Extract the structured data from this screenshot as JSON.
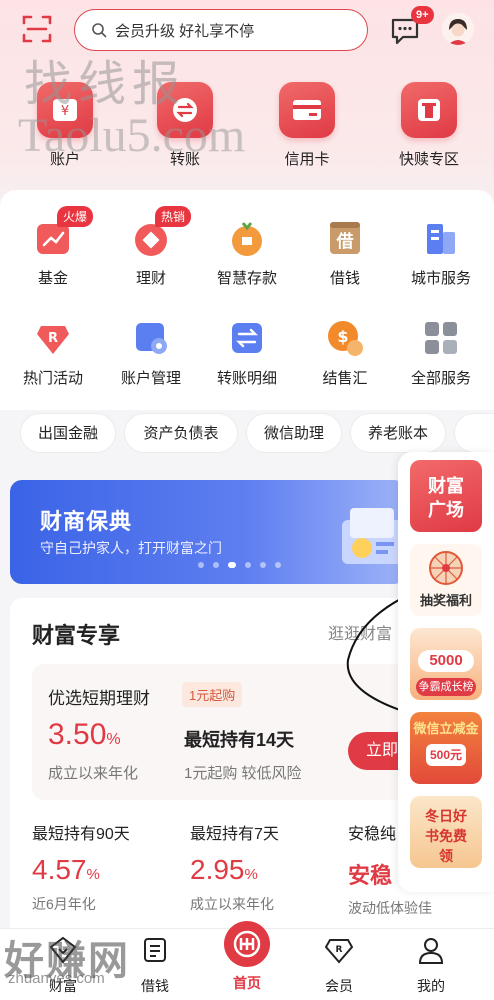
{
  "header": {
    "search_placeholder": "会员升级 好礼享不停",
    "message_badge": "9+"
  },
  "quick_tiles": [
    {
      "label": "账户",
      "icon": "wallet-icon"
    },
    {
      "label": "转账",
      "icon": "transfer-icon"
    },
    {
      "label": "信用卡",
      "icon": "credit-card-icon"
    },
    {
      "label": "快赎专区",
      "icon": "redeem-icon"
    }
  ],
  "services": [
    {
      "label": "基金",
      "icon": "fund-icon",
      "tag": "火爆"
    },
    {
      "label": "理财",
      "icon": "finance-icon",
      "tag": "热销"
    },
    {
      "label": "智慧存款",
      "icon": "deposit-icon"
    },
    {
      "label": "借钱",
      "icon": "borrow-icon",
      "glyph": "借"
    },
    {
      "label": "城市服务",
      "icon": "city-icon"
    },
    {
      "label": "热门活动",
      "icon": "activity-icon"
    },
    {
      "label": "账户管理",
      "icon": "account-manage-icon"
    },
    {
      "label": "转账明细",
      "icon": "transfer-detail-icon"
    },
    {
      "label": "结售汇",
      "icon": "exchange-icon"
    },
    {
      "label": "全部服务",
      "icon": "all-services-icon"
    }
  ],
  "chips": [
    "出国金融",
    "资产负债表",
    "微信助理",
    "养老账本"
  ],
  "banner": {
    "title": "财商保典",
    "subtitle": "守自己护家人，打开财富之门"
  },
  "side_panel": {
    "wealth_plaza": "财富广场",
    "lottery": "抽奖福利",
    "growth_amount": "5000",
    "growth_button": "争霸成长榜",
    "wechat_title": "微信立减金",
    "wechat_amount": "500元",
    "book_title": "冬日好书免费领"
  },
  "wealth": {
    "title": "财富专享",
    "more": "逛逛财富",
    "featured": {
      "name": "优选短期理财",
      "tag": "1元起购",
      "rate": "3.50",
      "rate_unit": "%",
      "rate_desc": "成立以来年化",
      "hold": "最短持有14天",
      "hold_desc": "1元起购 较低风险",
      "button": "立即"
    },
    "products": [
      {
        "head": "最短持有90天",
        "value": "4.57",
        "unit": "%",
        "desc": "近6月年化"
      },
      {
        "head": "最短持有7天",
        "value": "2.95",
        "unit": "%",
        "desc": "成立以来年化"
      },
      {
        "head": "安稳纯",
        "value": "安稳",
        "unit": "",
        "desc": "波动低体验佳"
      }
    ]
  },
  "nav": [
    {
      "label": "财富",
      "icon": "wealth-icon"
    },
    {
      "label": "借钱",
      "icon": "borrow-nav-icon"
    },
    {
      "label": "首页",
      "icon": "home-logo-icon",
      "active": true
    },
    {
      "label": "会员",
      "icon": "member-icon"
    },
    {
      "label": "我的",
      "icon": "profile-icon"
    }
  ],
  "watermarks": {
    "wm1": "找线报",
    "wm2": "Taolu5.com",
    "wm3": "好赚网",
    "wm4": "zhuanyes.com"
  },
  "colors": {
    "brand": "#e03a44",
    "banner": "#3a63e6"
  }
}
